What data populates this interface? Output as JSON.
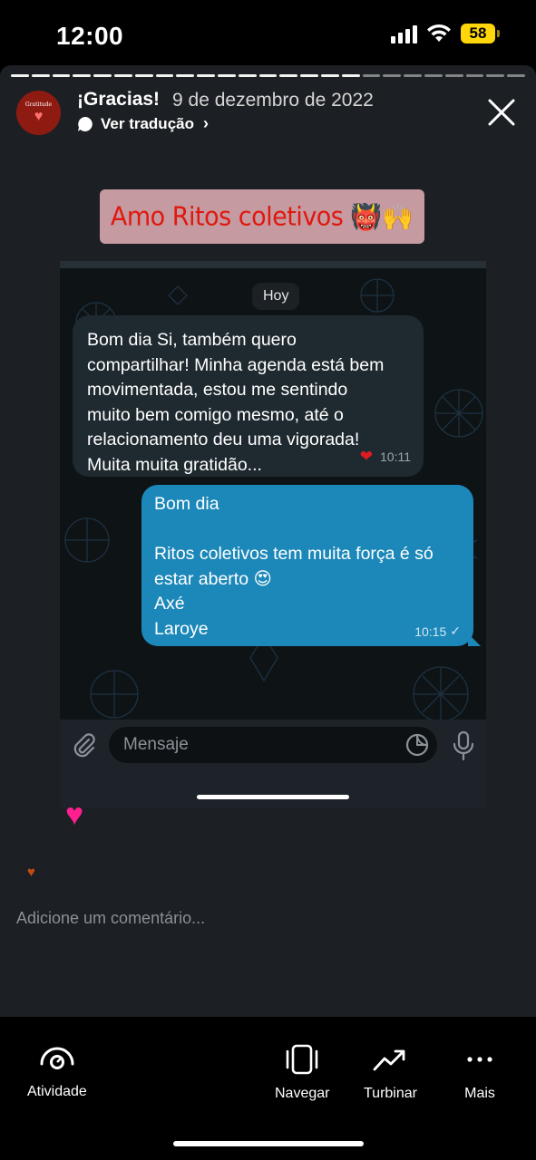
{
  "status_bar": {
    "time": "12:00",
    "battery": "58"
  },
  "story": {
    "title": "¡Gracias!",
    "date": "9 de dezembro de 2022",
    "translate_label": "Ver tradução",
    "avatar_text": "Gratitude",
    "sticker_text": "Amo Ritos coletivos",
    "sticker_emojis": "👹🙌"
  },
  "chat": {
    "day_chip": "Hoy",
    "incoming": {
      "text": "Bom dia Si, também quero\ncompartilhar! Minha agenda está bem\nmovimentada, estou me sentindo\nmuito bem comigo mesmo, até o\nrelacionamento deu uma vigorada!\nMuita muita gratidão...",
      "time": "10:11",
      "reaction": "❤"
    },
    "outgoing": {
      "text": "Bom dia\n\nRitos coletivos tem muita força é só\nestar aberto 😍\nAxé\nLaroye",
      "time": "10:15",
      "check": "✓"
    },
    "input_placeholder": "Mensaje"
  },
  "reactions": {
    "big_heart": "♥",
    "small_heart": "♥"
  },
  "comment": {
    "placeholder": "Adicione um comentário..."
  },
  "toolbar": {
    "activity": "Atividade",
    "navigate": "Navegar",
    "boost": "Turbinar",
    "more": "Mais"
  }
}
